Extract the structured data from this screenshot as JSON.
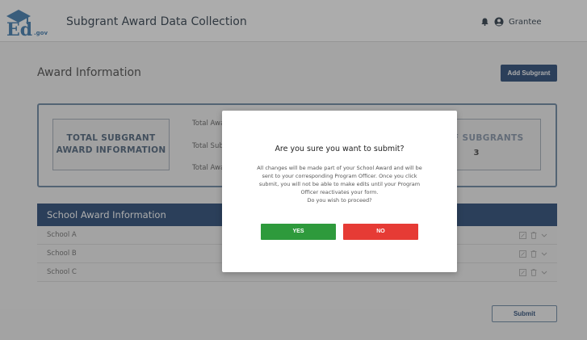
{
  "header": {
    "logo_text": "Ed.gov",
    "title": "Subgrant Award Data Collection",
    "notification_icon": "bell-icon",
    "user_icon": "user-circle-icon",
    "user_label": "Grantee"
  },
  "page": {
    "title": "Award Information",
    "add_button": "Add Subgrant",
    "submit_button": "Submit"
  },
  "summary": {
    "total_title_line1": "TOTAL SUBGRANT",
    "total_title_line2": "AWARD INFORMATION",
    "lines": [
      "Total Awa",
      "Total Sub",
      "Total Awa"
    ],
    "count_label": "ER OF SUBGRANTS",
    "count_value": "3"
  },
  "table": {
    "header": "School Award Information",
    "rows": [
      "School A",
      "School B",
      "School C"
    ],
    "row_icons": [
      "edit-icon",
      "trash-icon",
      "chevron-down-icon"
    ]
  },
  "modal": {
    "title": "Are you sure you want to submit?",
    "body_lines": [
      "All changes will be made part of your School Award and will be",
      "sent to your corresponding Program Officer. Once you click",
      "submit, you will not be able to make edits until your Program",
      "Officer reactivates your form.",
      "Do you wish to proceed?"
    ],
    "yes_label": "YES",
    "no_label": "NO"
  },
  "colors": {
    "navy": "#15396a",
    "yes_green": "#2e9a3c",
    "no_red": "#e63b35",
    "border_blue": "#5e7c9a"
  }
}
